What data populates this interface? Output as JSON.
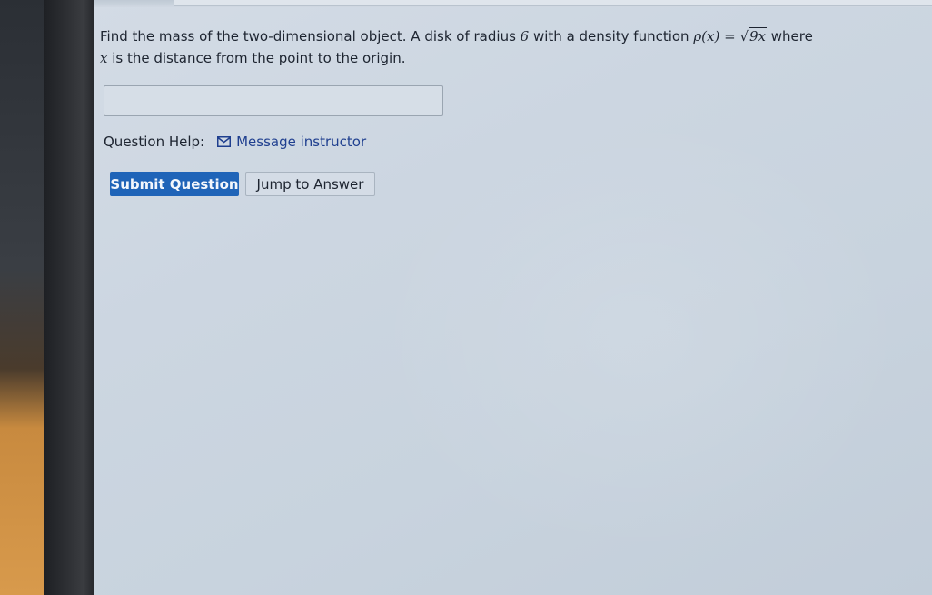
{
  "question": {
    "text_before": "Find the mass of the two-dimensional object. A disk of radius ",
    "radius": "6",
    "text_mid": " with a density function ",
    "density_lhs": "ρ(x) = ",
    "radical": "√",
    "radicand": "9x",
    "text_after": " where ",
    "variable": "x",
    "text_end": " is the distance from the point to the origin."
  },
  "answer": {
    "value": ""
  },
  "help": {
    "label": "Question Help:",
    "message_link": "Message instructor",
    "icon": "envelope-icon"
  },
  "buttons": {
    "submit": "Submit Question",
    "jump": "Jump to Answer"
  },
  "colors": {
    "submit_bg": "#1f64b8",
    "link": "#1f3f8f"
  }
}
